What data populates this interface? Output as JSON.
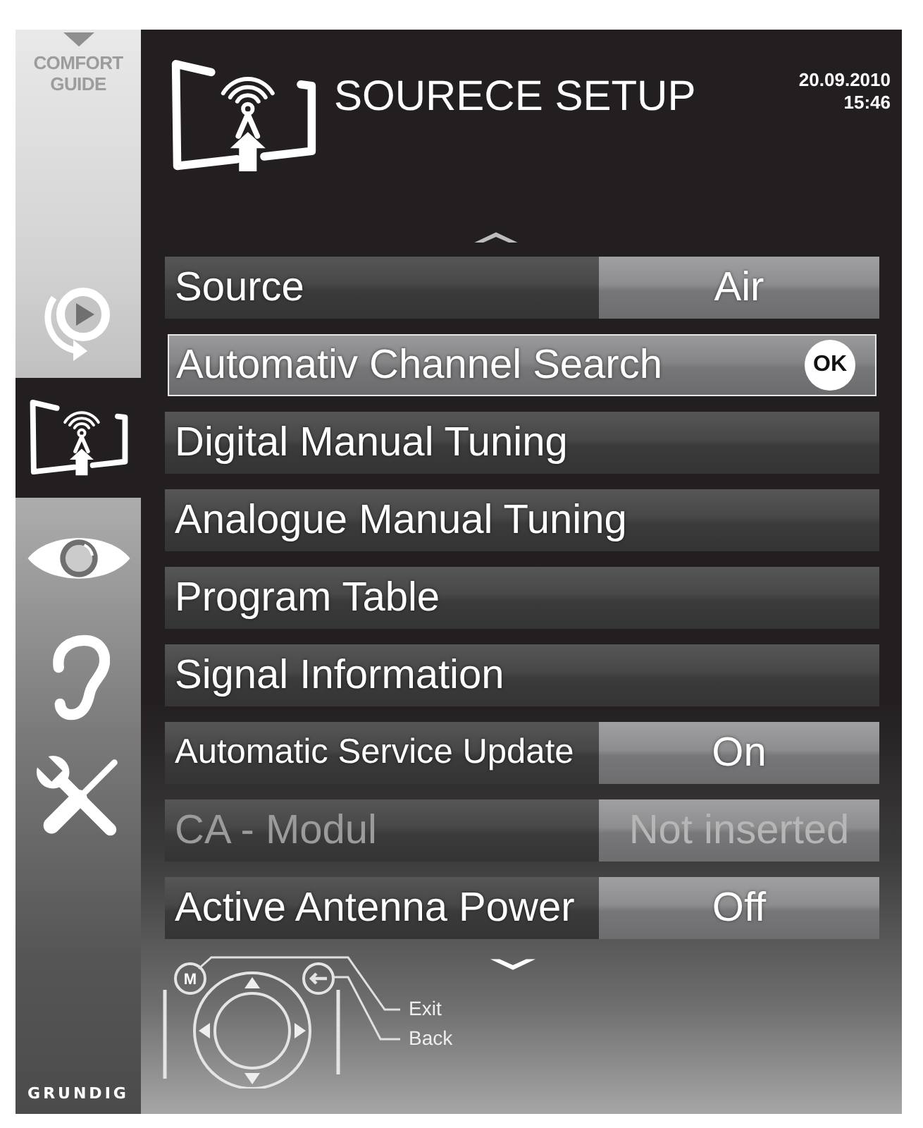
{
  "sidebar": {
    "comfort_guide": "COMFORT GUIDE",
    "items": [
      {
        "kind": "playback",
        "selected": false
      },
      {
        "kind": "source",
        "selected": true
      },
      {
        "kind": "picture",
        "selected": false
      },
      {
        "kind": "sound",
        "selected": false
      },
      {
        "kind": "settings",
        "selected": false
      }
    ],
    "brand": "GRUNDIG"
  },
  "header": {
    "title": "SOURECE SETUP",
    "date": "20.09.2010",
    "time": "15:46"
  },
  "menu": {
    "rows": [
      {
        "kind": "value",
        "label": "Source",
        "value": "Air",
        "selected": false,
        "disabled": false
      },
      {
        "kind": "action",
        "label": "Automativ Channel Search",
        "key": "OK",
        "selected": true,
        "disabled": false
      },
      {
        "kind": "plain",
        "label": "Digital Manual Tuning",
        "selected": false,
        "disabled": false
      },
      {
        "kind": "plain",
        "label": "Analogue Manual Tuning",
        "selected": false,
        "disabled": false
      },
      {
        "kind": "plain",
        "label": "Program Table",
        "selected": false,
        "disabled": false
      },
      {
        "kind": "plain",
        "label": "Signal Information",
        "selected": false,
        "disabled": false
      },
      {
        "kind": "value",
        "label": "Automatic Service Update",
        "value": "On",
        "selected": false,
        "disabled": false
      },
      {
        "kind": "value",
        "label": "CA - Modul",
        "value": "Not inserted",
        "selected": false,
        "disabled": true
      },
      {
        "kind": "value",
        "label": "Active Antenna Power",
        "value": "Off",
        "selected": false,
        "disabled": false
      }
    ]
  },
  "remote_legend": {
    "menu_key": "M",
    "exit": "Exit",
    "back": "Back"
  }
}
